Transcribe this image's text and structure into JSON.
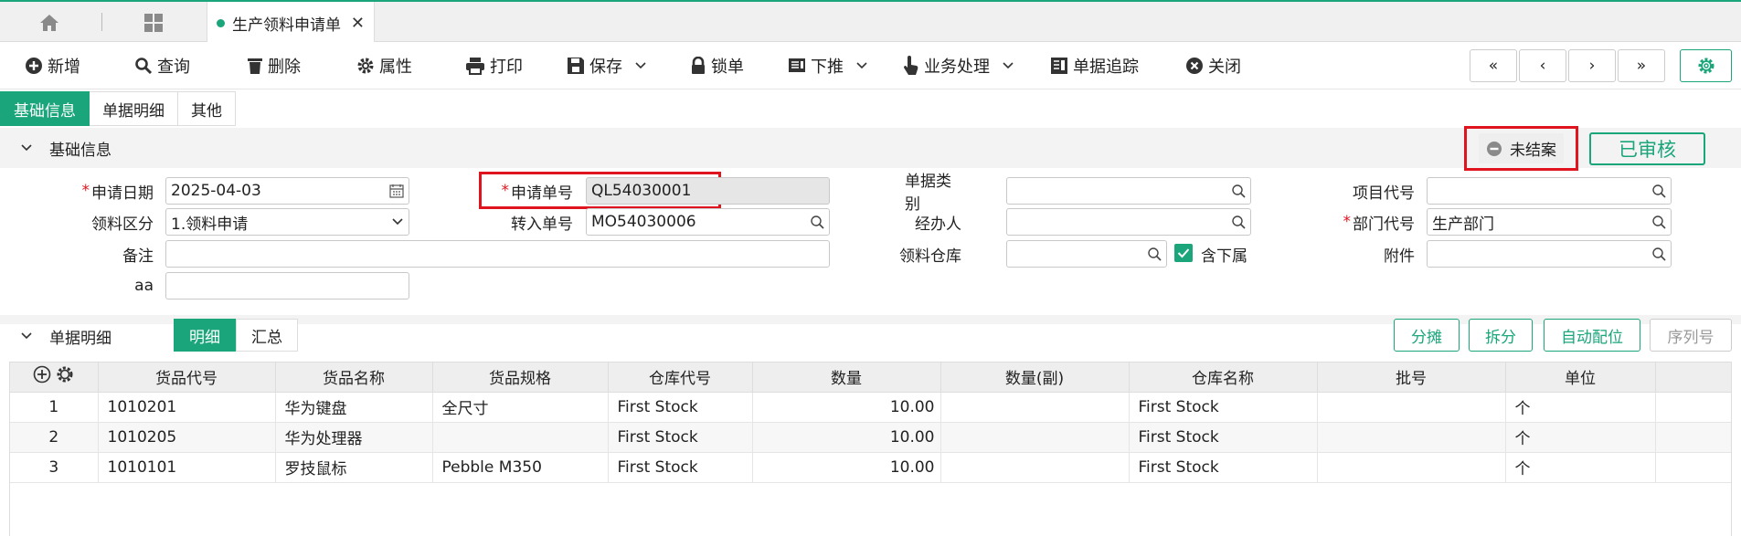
{
  "tabs": {
    "active_label": "生产领料申请单"
  },
  "toolbar": {
    "new": "新增",
    "query": "查询",
    "delete": "删除",
    "props": "属性",
    "print": "打印",
    "save": "保存",
    "lock": "锁单",
    "push_down": "下推",
    "business": "业务处理",
    "trace": "单据追踪",
    "close": "关闭"
  },
  "subtabs": [
    "基础信息",
    "单据明细",
    "其他"
  ],
  "basic": {
    "section_title": "基础信息",
    "status": "未结案",
    "audited": "已审核",
    "labels": {
      "apply_date": "申请日期",
      "apply_no": "申请单号",
      "doc_type": "单据类别",
      "project_code": "项目代号",
      "pick_type": "领料区分",
      "transfer_no": "转入单号",
      "handler": "经办人",
      "dept_code": "部门代号",
      "remark": "备注",
      "warehouse": "领料仓库",
      "include_sub": "含下属",
      "attachment": "附件",
      "aa": "aa"
    },
    "values": {
      "apply_date": "2025-04-03",
      "apply_no": "QL54030001",
      "doc_type": "",
      "project_code": "",
      "pick_type": "1.领料申请",
      "transfer_no": "MO54030006",
      "handler": "",
      "dept_code": "生产部门",
      "remark": "",
      "warehouse": "",
      "attachment": "",
      "aa": ""
    },
    "include_sub_checked": true
  },
  "detail": {
    "section_title": "单据明细",
    "view_tabs": [
      "明细",
      "汇总"
    ],
    "actions": {
      "allocate": "分摊",
      "split": "拆分",
      "auto_locate": "自动配位",
      "serial": "序列号"
    },
    "columns": [
      "货品代号",
      "货品名称",
      "货品规格",
      "仓库代号",
      "数量",
      "数量(副)",
      "仓库名称",
      "批号",
      "单位"
    ],
    "rows": [
      {
        "no": "1",
        "code": "1010201",
        "name": "华为键盘",
        "spec": "全尺寸",
        "wh_code": "First Stock",
        "qty": "10.00",
        "qty2": "",
        "wh_name": "First Stock",
        "batch": "",
        "unit": "个"
      },
      {
        "no": "2",
        "code": "1010205",
        "name": "华为处理器",
        "spec": "",
        "wh_code": "First Stock",
        "qty": "10.00",
        "qty2": "",
        "wh_name": "First Stock",
        "batch": "",
        "unit": "个"
      },
      {
        "no": "3",
        "code": "1010101",
        "name": "罗技鼠标",
        "spec": "Pebble M350",
        "wh_code": "First Stock",
        "qty": "10.00",
        "qty2": "",
        "wh_name": "First Stock",
        "batch": "",
        "unit": "个"
      }
    ]
  }
}
